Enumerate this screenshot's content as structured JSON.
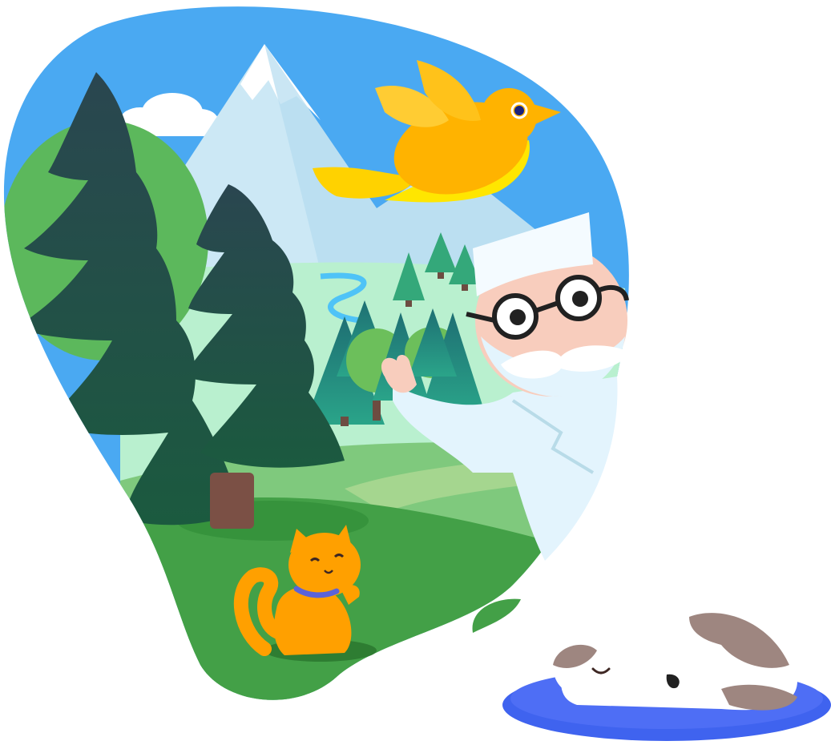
{
  "colors": {
    "background": "#ffffff",
    "sky": "#4aa9f2",
    "mountain": "#d8eef8",
    "meadow": "#b9f0cf",
    "grass_light": "#7fc97d",
    "grass": "#43a047",
    "pine_dark": "#1f4d45",
    "pine_teal": "#1f8f83",
    "bird": "#ffb300",
    "cat": "#ffa000",
    "cat_collar": "#5a63d9",
    "cushion": "#3f63ef",
    "dog_spots": "#9e8680",
    "doctor_coat": "#e3f4fd",
    "skin": "#f8cdbd"
  },
  "illustration": {
    "elements": [
      "sky-with-cloud",
      "snowy-mountain",
      "pine-forest",
      "river",
      "yellow-bird",
      "doctor",
      "orange-cat",
      "sleeping-dog",
      "blue-cushion"
    ]
  }
}
